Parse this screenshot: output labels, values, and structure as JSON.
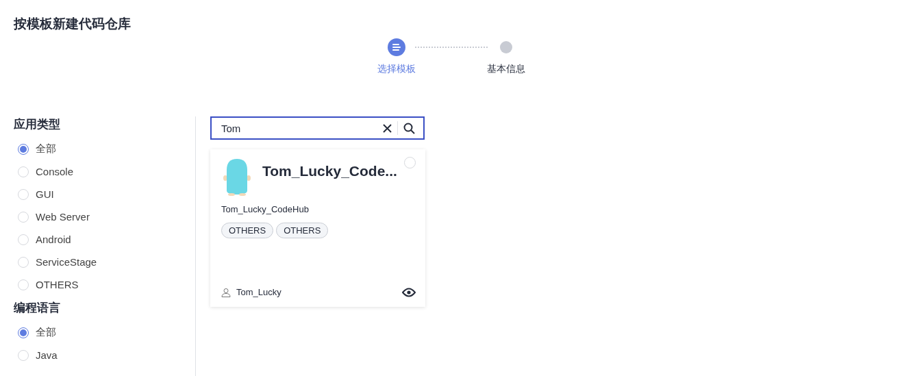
{
  "page_title": "按模板新建代码仓库",
  "steps": [
    {
      "label": "选择模板",
      "selected": true
    },
    {
      "label": "基本信息",
      "selected": false
    }
  ],
  "filters": [
    {
      "heading": "应用类型",
      "options": [
        {
          "label": "全部",
          "selected": true
        },
        {
          "label": "Console",
          "selected": false
        },
        {
          "label": "GUI",
          "selected": false
        },
        {
          "label": "Web Server",
          "selected": false
        },
        {
          "label": "Android",
          "selected": false
        },
        {
          "label": "ServiceStage",
          "selected": false
        },
        {
          "label": "OTHERS",
          "selected": false
        }
      ]
    },
    {
      "heading": "编程语言",
      "options": [
        {
          "label": "全部",
          "selected": true
        },
        {
          "label": "Java",
          "selected": false
        }
      ]
    }
  ],
  "search": {
    "value": "Tom"
  },
  "templates": [
    {
      "title": "Tom_Lucky_Code...",
      "description": "Tom_Lucky_CodeHub",
      "tags": [
        "OTHERS",
        "OTHERS"
      ],
      "author": "Tom_Lucky",
      "selected": false
    }
  ]
}
